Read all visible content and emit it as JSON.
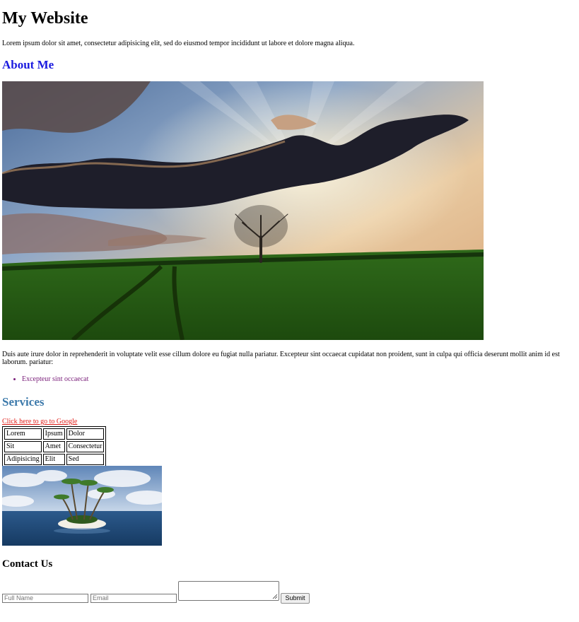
{
  "header": {
    "title": "My Website",
    "intro": "Lorem ipsum dolor sit amet, consectetur adipisicing elit, sed do eiusmod tempor incididunt ut labore et dolore magna aliqua."
  },
  "about": {
    "heading": "About Me",
    "heading_color": "#1a1adf",
    "paragraph": "Duis aute irure dolor in reprehenderit in voluptate velit esse cillum dolore eu fugiat nulla pariatur. Excepteur sint occaecat cupidatat non proident, sunt in culpa qui officia deserunt mollit anim id est laborum. pariatur:",
    "list": [
      "Excepteur sint occaecat"
    ],
    "list_color": "#7a1f7a"
  },
  "services": {
    "heading": "Services",
    "heading_color": "#3d7aab",
    "link_text": "Click here to go to Google",
    "link_color": "#e0201a",
    "table": [
      [
        "Lorem",
        "Ipsum",
        "Dolor"
      ],
      [
        "Sit",
        "Amet",
        "Consectetur"
      ],
      [
        "Adipisicing",
        "Elit",
        "Sed"
      ]
    ]
  },
  "contact": {
    "heading": "Contact Us",
    "name_placeholder": "Full Name",
    "email_placeholder": "Email",
    "message_value": "",
    "submit_label": "Submit"
  }
}
